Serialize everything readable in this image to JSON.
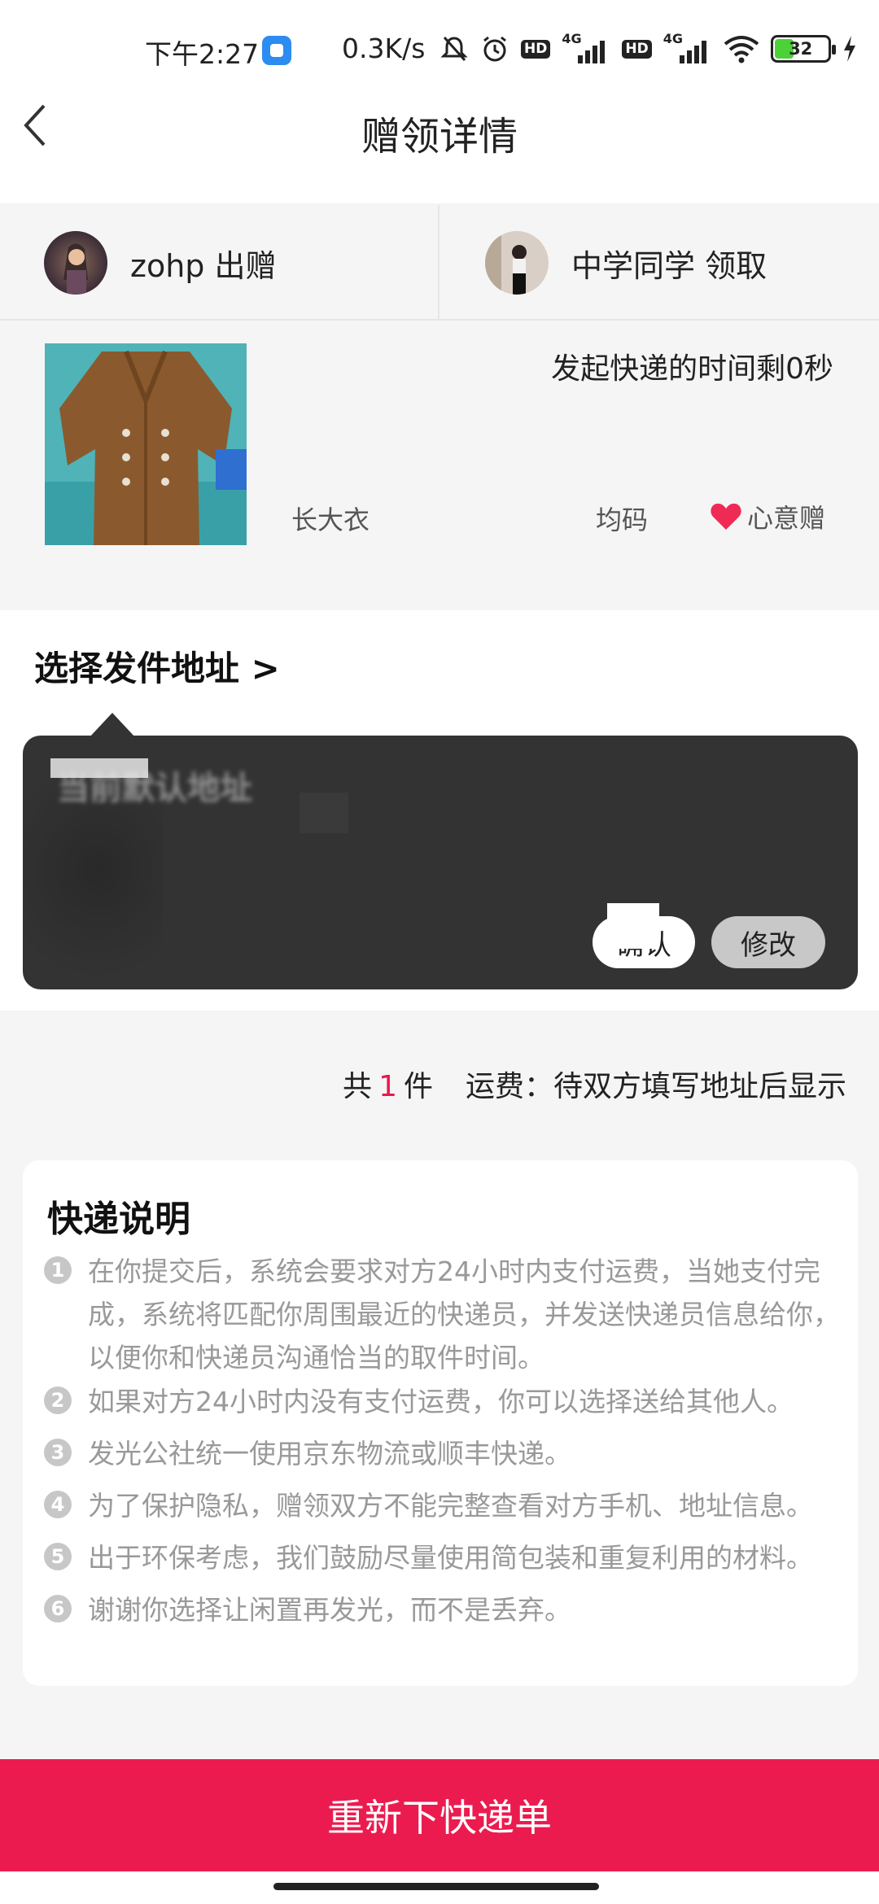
{
  "status_bar": {
    "time": "下午2:27",
    "speed": "0.3K/s",
    "hd": "HD",
    "net1": "4G",
    "net2": "4G",
    "battery": "32"
  },
  "nav": {
    "title": "赠领详情"
  },
  "users": {
    "giver": "zohp 出赠",
    "receiver": "中学同学 领取"
  },
  "item": {
    "countdown": "发起快递的时间剩0秒",
    "name": "长大衣",
    "size": "均码",
    "gift_type": "心意赠"
  },
  "address": {
    "title": "选择发件地址 >",
    "tooltip_heading": "当前默认地址",
    "confirm_label": "确认",
    "modify_label": "修改"
  },
  "summary": {
    "prefix": "共",
    "count": "1",
    "suffix": "件",
    "shipping": "运费：待双方填写地址后显示"
  },
  "notes": {
    "title": "快递说明",
    "items": [
      {
        "num": "1",
        "text": "在你提交后，系统会要求对方24小时内支付运费，当她支付完成，系统将匹配你周围最近的快递员，并发送快递员信息给你，以便你和快递员沟通恰当的取件时间。"
      },
      {
        "num": "2",
        "text": "如果对方24小时内没有支付运费，你可以选择送给其他人。"
      },
      {
        "num": "3",
        "text": "发光公社统一使用京东物流或顺丰快递。"
      },
      {
        "num": "4",
        "text": "为了保护隐私，赠领双方不能完整查看对方手机、地址信息。"
      },
      {
        "num": "5",
        "text": "出于环保考虑，我们鼓励尽量使用简包装和重复利用的材料。"
      },
      {
        "num": "6",
        "text": "谢谢你选择让闲置再发光，而不是丢弃。"
      }
    ]
  },
  "bottom": {
    "button_label": "重新下快递单"
  },
  "colors": {
    "accent": "#ec1b4f",
    "tooltip_bg": "#333333",
    "muted_text": "#999999"
  }
}
